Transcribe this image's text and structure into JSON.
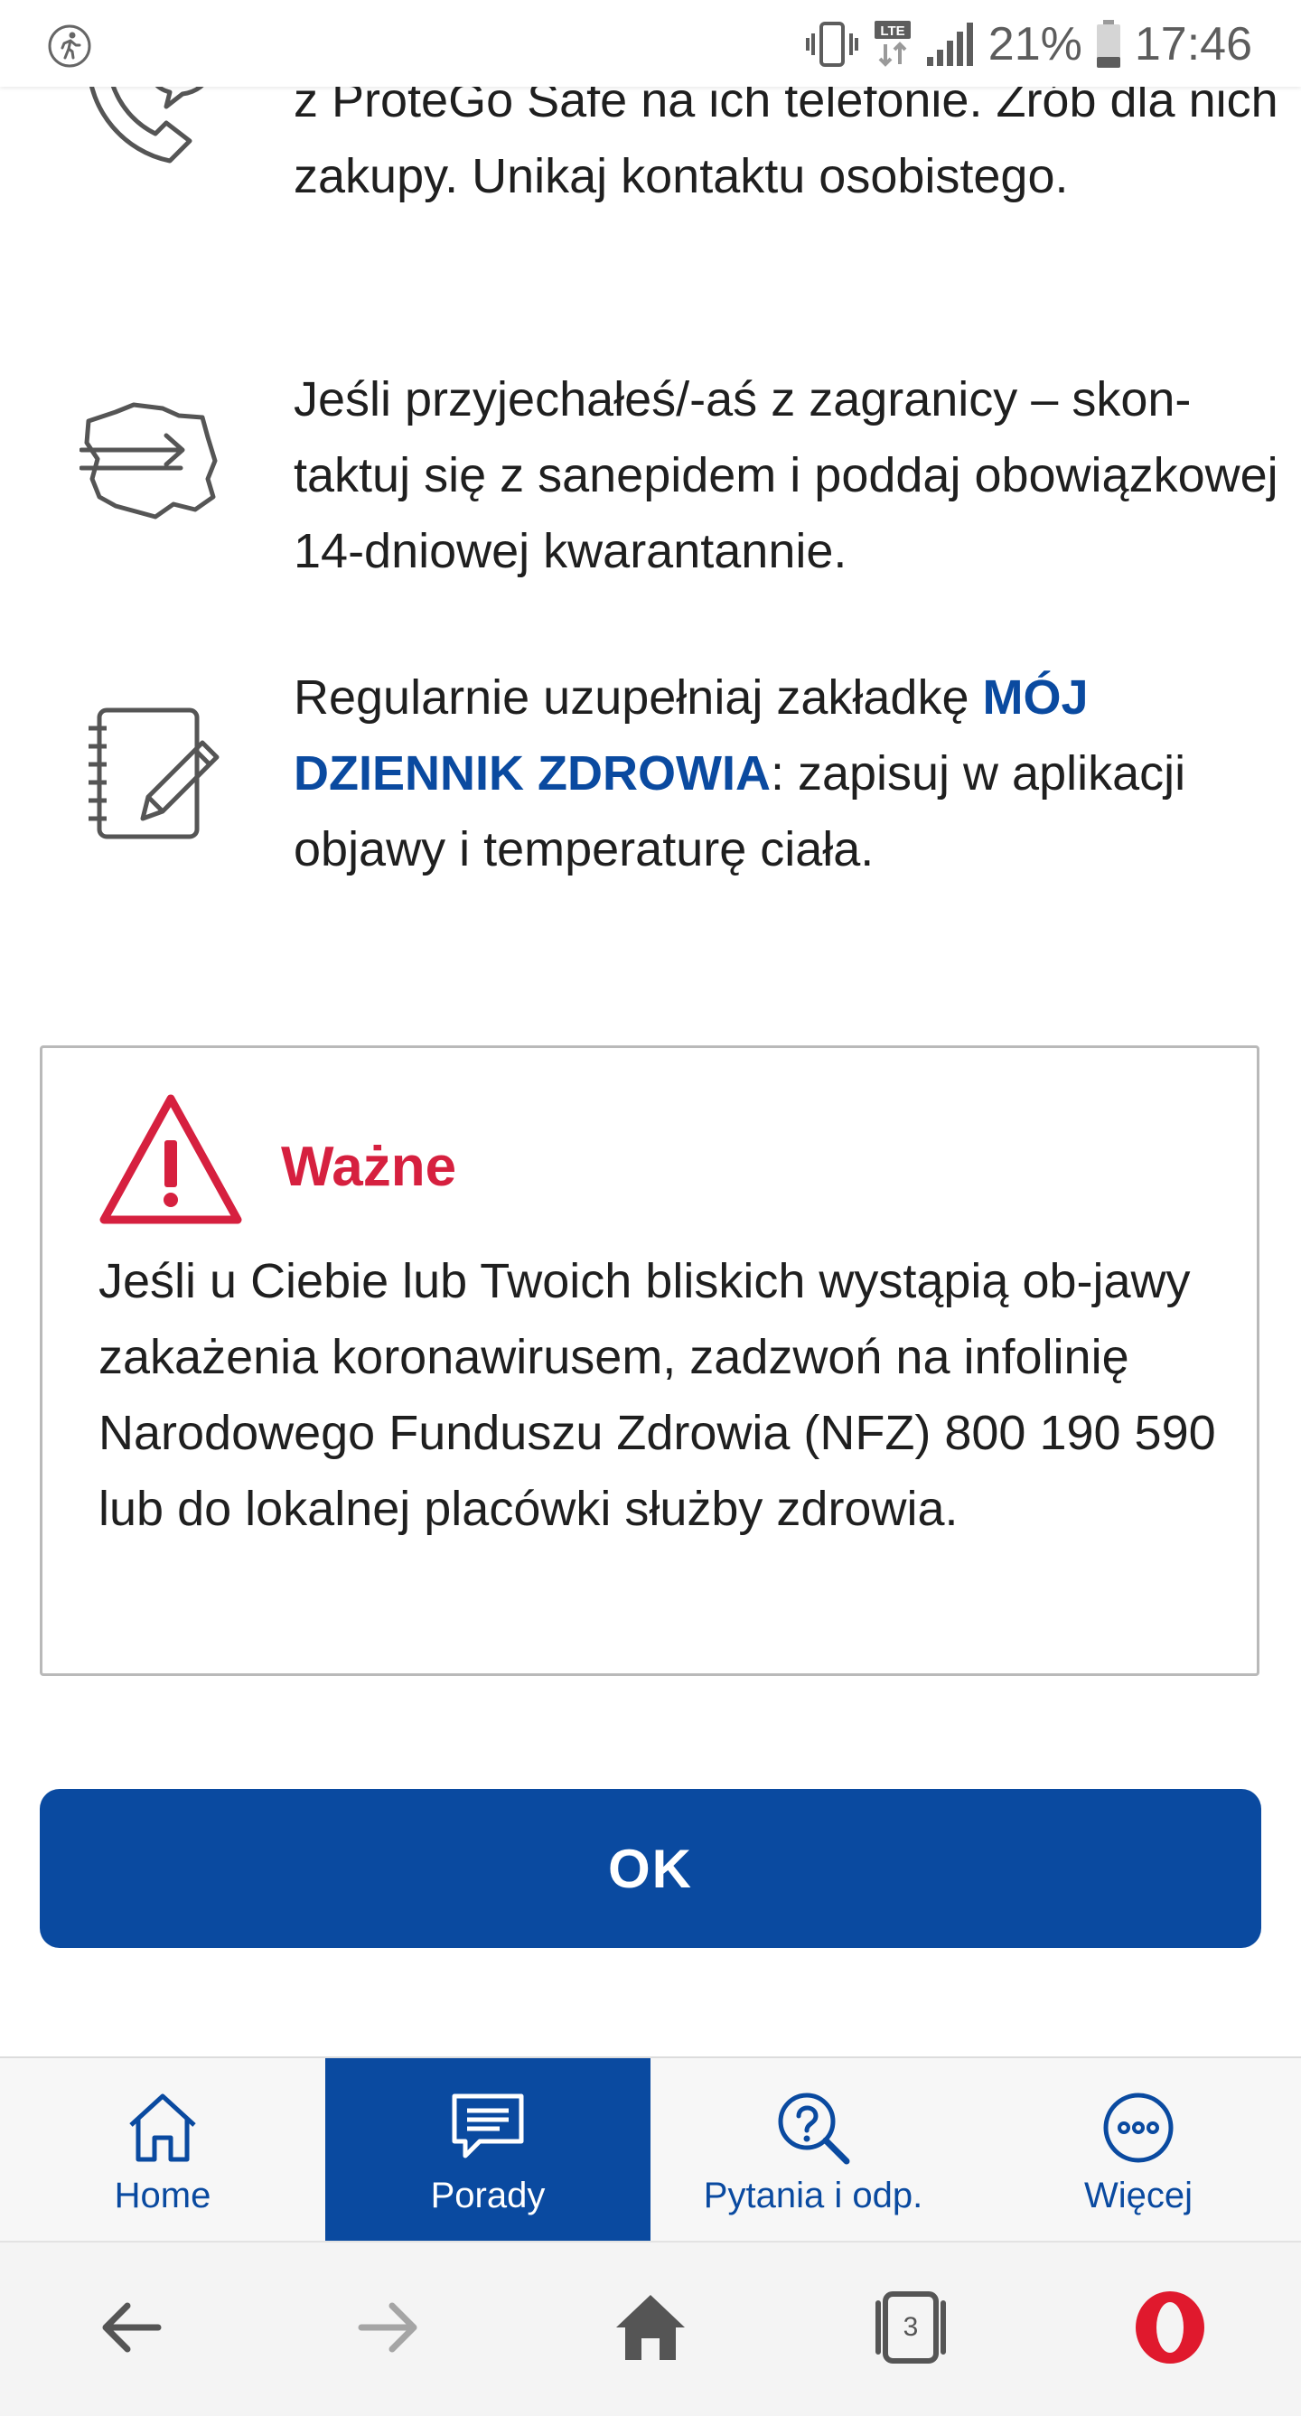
{
  "status_bar": {
    "battery_percent": "21%",
    "time": "17:46",
    "network": "LTE",
    "icons": [
      "running-person-icon",
      "vibrate-icon",
      "lte-icon",
      "signal-icon",
      "battery-icon"
    ]
  },
  "tips": [
    {
      "icon": "phone-chat-icon",
      "text": "z ProteGo Safe na ich telefonie. Zrób dla nich zakupy. Unikaj kontaktu osobistego."
    },
    {
      "icon": "poland-map-arrow-icon",
      "text": "Jeśli przyjechałeś/-aś z zagranicy – skon-taktuj się z sanepidem i poddaj obowiązkowej 14-dniowej kwarantannie."
    },
    {
      "icon": "notebook-pencil-icon",
      "text_before": "Regularnie uzupełniaj zakładkę ",
      "link": "MÓJ DZIENNIK ZDROWIA",
      "text_after": ": zapisuj w aplikacji objawy i temperaturę ciała."
    }
  ],
  "important": {
    "icon": "warning-triangle-icon",
    "title": "Ważne",
    "text": "Jeśli u Ciebie lub Twoich bliskich wystąpią ob-jawy zakażenia koronawirusem, zadzwoń na infolinię Narodowego Funduszu Zdrowia (NFZ) 800 190 590 lub do lokalnej placówki służby zdrowia."
  },
  "ok_button": {
    "label": "OK"
  },
  "app_nav": {
    "items": [
      {
        "label": "Home",
        "icon": "home-icon",
        "active": false
      },
      {
        "label": "Porady",
        "icon": "chat-advice-icon",
        "active": true
      },
      {
        "label": "Pytania i odp.",
        "icon": "question-search-icon",
        "active": false
      },
      {
        "label": "Więcej",
        "icon": "more-dots-icon",
        "active": false
      }
    ]
  },
  "browser_bar": {
    "tabs_count": "3",
    "icons": [
      "back-arrow-icon",
      "forward-arrow-icon",
      "home-icon",
      "tabs-icon",
      "opera-icon"
    ]
  },
  "colors": {
    "brand_blue": "#0a4aa0",
    "warning_red": "#d6203f"
  }
}
